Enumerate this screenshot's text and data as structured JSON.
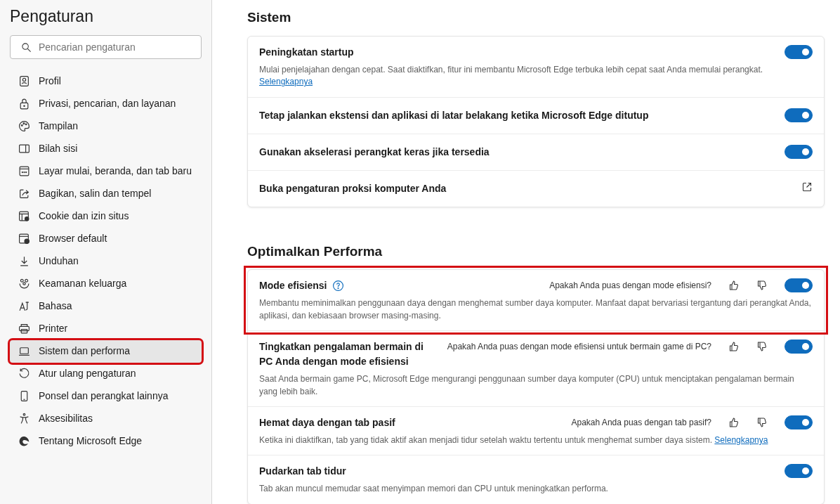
{
  "sidebar": {
    "title": "Pengaturan",
    "search": {
      "placeholder": "Pencarian pengaturan"
    },
    "items": [
      {
        "label": "Profil",
        "selected": false,
        "highlighted": false
      },
      {
        "label": "Privasi, pencarian, dan layanan",
        "selected": false,
        "highlighted": false
      },
      {
        "label": "Tampilan",
        "selected": false,
        "highlighted": false
      },
      {
        "label": "Bilah sisi",
        "selected": false,
        "highlighted": false
      },
      {
        "label": "Layar mulai, beranda, dan tab baru",
        "selected": false,
        "highlighted": false
      },
      {
        "label": "Bagikan, salin dan tempel",
        "selected": false,
        "highlighted": false
      },
      {
        "label": "Cookie dan izin situs",
        "selected": false,
        "highlighted": false
      },
      {
        "label": "Browser default",
        "selected": false,
        "highlighted": false
      },
      {
        "label": "Unduhan",
        "selected": false,
        "highlighted": false
      },
      {
        "label": "Keamanan keluarga",
        "selected": false,
        "highlighted": false
      },
      {
        "label": "Bahasa",
        "selected": false,
        "highlighted": false
      },
      {
        "label": "Printer",
        "selected": false,
        "highlighted": false
      },
      {
        "label": "Sistem dan performa",
        "selected": true,
        "highlighted": true
      },
      {
        "label": "Atur ulang pengaturan",
        "selected": false,
        "highlighted": false
      },
      {
        "label": "Ponsel dan perangkat lainnya",
        "selected": false,
        "highlighted": false
      },
      {
        "label": "Aksesibilitas",
        "selected": false,
        "highlighted": false
      },
      {
        "label": "Tentang Microsoft Edge",
        "selected": false,
        "highlighted": false
      }
    ]
  },
  "sections": [
    {
      "title": "Sistem",
      "settings": [
        {
          "kind": "toggle",
          "title": "Peningkatan startup",
          "on": true,
          "description": "Mulai penjelajahan dengan cepat. Saat diaktifkan, fitur ini membantu Microsoft Edge terbuka lebih cepat saat Anda memulai perangkat.",
          "link": "Selengkapnya"
        },
        {
          "kind": "toggle",
          "title": "Tetap jalankan ekstensi dan aplikasi di latar belakang ketika Microsoft Edge ditutup",
          "on": true
        },
        {
          "kind": "toggle",
          "title": "Gunakan akselerasi perangkat keras jika tersedia",
          "on": true
        },
        {
          "kind": "external",
          "title": "Buka pengaturan proksi komputer Anda"
        }
      ]
    },
    {
      "title": "Optimalkan Performa",
      "settings": [
        {
          "kind": "toggle",
          "title": "Mode efisiensi",
          "help": true,
          "highlighted": true,
          "feedback": "Apakah Anda puas dengan mode efisiensi?",
          "on": true,
          "description": "Membantu meminimalkan penggunaan daya dengan menghemat sumber daya komputer. Manfaat dapat bervariasi tergantung dari perangkat Anda, aplikasi, dan kebiasaan browser masing-masing."
        },
        {
          "kind": "toggle",
          "title": "Tingkatkan pengalaman bermain di PC Anda dengan mode efisiensi",
          "feedback": "Apakah Anda puas dengan mode efisiensi untuk bermain game di PC?",
          "on": true,
          "description": "Saat Anda bermain game PC, Microsoft Edge mengurangi penggunaan sumber daya komputer (CPU) untuk menciptakan pengalaman bermain yang lebih baik."
        },
        {
          "kind": "toggle",
          "title": "Hemat daya dengan tab pasif",
          "feedback": "Apakah Anda puas dengan tab pasif?",
          "on": true,
          "description": "Ketika ini diaktifkan, tab yang tidak aktif akan menjadi tidur setelah waktu tertentu untuk menghemat sumber daya sistem.",
          "link": "Selengkapnya"
        },
        {
          "kind": "toggle",
          "title": "Pudarkan tab tidur",
          "on": true,
          "description": "Tab akan muncul memudar saat menyimpan memori dan CPU untuk meningkatkan performa."
        }
      ]
    }
  ]
}
